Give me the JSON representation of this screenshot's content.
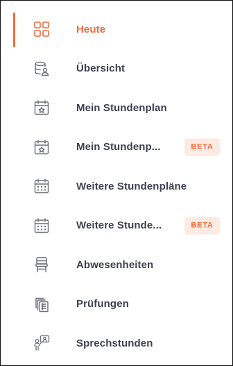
{
  "colors": {
    "accent": "#f26b3a",
    "text": "#3e4150",
    "icon": "#6b6e78",
    "badge_bg": "#fdeae3"
  },
  "nav": {
    "items": [
      {
        "label": "Heute",
        "icon": "grid-icon",
        "active": true
      },
      {
        "label": "Übersicht",
        "icon": "database-user-icon"
      },
      {
        "label": "Mein Stundenplan",
        "icon": "calendar-star-icon"
      },
      {
        "label": "Mein Stundenp...",
        "icon": "calendar-star-icon",
        "badge": "BETA"
      },
      {
        "label": "Weitere Stundenpläne",
        "icon": "calendar-grid-icon"
      },
      {
        "label": "Weitere Stunde...",
        "icon": "calendar-grid-icon",
        "badge": "BETA"
      },
      {
        "label": "Abwesenheiten",
        "icon": "chair-icon"
      },
      {
        "label": "Prüfungen",
        "icon": "documents-icon"
      },
      {
        "label": "Sprechstunden",
        "icon": "consultation-icon"
      }
    ]
  }
}
